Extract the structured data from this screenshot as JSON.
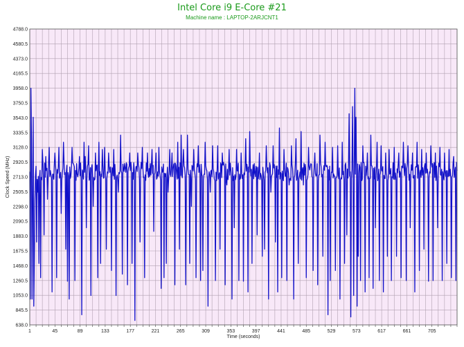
{
  "chart_data": {
    "type": "line",
    "title": "Intel Core i9 E-Core #21",
    "subtitle": "Machine name : LAPTOP-2ARJCNT1",
    "xlabel": "Time (seconds)",
    "ylabel": "Clock Speed (MHz)",
    "x_ticks": [
      "1",
      "45",
      "89",
      "133",
      "177",
      "221",
      "265",
      "309",
      "353",
      "397",
      "441",
      "485",
      "529",
      "573",
      "617",
      "661",
      "705"
    ],
    "y_ticks": [
      "638.0",
      "845.5",
      "1053.0",
      "1260.5",
      "1468.0",
      "1675.5",
      "1883.0",
      "2090.5",
      "2298.0",
      "2505.5",
      "2713.0",
      "2920.5",
      "3128.0",
      "3335.5",
      "3543.0",
      "3750.5",
      "3958.0",
      "4165.5",
      "4373.0",
      "4580.5",
      "4788.0"
    ],
    "xlim": [
      1,
      749
    ],
    "ylim": [
      638.0,
      4788.0
    ],
    "grid": true,
    "colors": {
      "line": "#1010c8",
      "plot_bg": "#f8e8f8",
      "grid": "#b0a0b0",
      "title": "#1a9a1a"
    },
    "baseline": 2790,
    "dips": [
      [
        2,
        1000
      ],
      [
        3,
        3958
      ],
      [
        4,
        3250
      ],
      [
        5,
        1000
      ],
      [
        6,
        2400
      ],
      [
        7,
        3550
      ],
      [
        8,
        900
      ],
      [
        9,
        1600
      ],
      [
        10,
        2400
      ],
      [
        13,
        1800
      ],
      [
        15,
        2500
      ],
      [
        17,
        1500
      ],
      [
        20,
        1300
      ],
      [
        23,
        3100
      ],
      [
        26,
        1900
      ],
      [
        29,
        3000
      ],
      [
        32,
        2400
      ],
      [
        35,
        3128
      ],
      [
        40,
        1100
      ],
      [
        45,
        3050
      ],
      [
        48,
        1300
      ],
      [
        52,
        3128
      ],
      [
        56,
        2200
      ],
      [
        60,
        3200
      ],
      [
        64,
        1700
      ],
      [
        67,
        1250
      ],
      [
        70,
        1000
      ],
      [
        75,
        3128
      ],
      [
        80,
        1260
      ],
      [
        83,
        2900
      ],
      [
        88,
        3000
      ],
      [
        92,
        780
      ],
      [
        96,
        3200
      ],
      [
        98,
        3000
      ],
      [
        100,
        2000
      ],
      [
        104,
        3150
      ],
      [
        108,
        1050
      ],
      [
        112,
        2300
      ],
      [
        116,
        3050
      ],
      [
        120,
        1300
      ],
      [
        122,
        3200
      ],
      [
        125,
        1500
      ],
      [
        128,
        3100
      ],
      [
        132,
        3128
      ],
      [
        135,
        1700
      ],
      [
        139,
        3050
      ],
      [
        144,
        1400
      ],
      [
        148,
        3100
      ],
      [
        152,
        1050
      ],
      [
        156,
        2500
      ],
      [
        160,
        3300
      ],
      [
        163,
        1350
      ],
      [
        167,
        2900
      ],
      [
        172,
        1200
      ],
      [
        176,
        3050
      ],
      [
        180,
        1500
      ],
      [
        185,
        700
      ],
      [
        190,
        3050
      ],
      [
        194,
        1800
      ],
      [
        198,
        3128
      ],
      [
        202,
        1300
      ],
      [
        207,
        3050
      ],
      [
        212,
        2900
      ],
      [
        215,
        3100
      ],
      [
        218,
        1950
      ],
      [
        222,
        3050
      ],
      [
        227,
        3128
      ],
      [
        231,
        1150
      ],
      [
        236,
        1300
      ],
      [
        240,
        1500
      ],
      [
        243,
        2500
      ],
      [
        246,
        3100
      ],
      [
        250,
        3050
      ],
      [
        255,
        1200
      ],
      [
        260,
        3200
      ],
      [
        263,
        1700
      ],
      [
        266,
        3300
      ],
      [
        270,
        3100
      ],
      [
        274,
        1200
      ],
      [
        277,
        3300
      ],
      [
        281,
        1500
      ],
      [
        284,
        2300
      ],
      [
        288,
        3100
      ],
      [
        292,
        1300
      ],
      [
        296,
        3150
      ],
      [
        300,
        1260
      ],
      [
        304,
        1400
      ],
      [
        308,
        3200
      ],
      [
        313,
        900
      ],
      [
        317,
        2500
      ],
      [
        321,
        3150
      ],
      [
        326,
        1260
      ],
      [
        330,
        3150
      ],
      [
        334,
        1700
      ],
      [
        338,
        3050
      ],
      [
        343,
        1200
      ],
      [
        346,
        2600
      ],
      [
        350,
        3100
      ],
      [
        355,
        1000
      ],
      [
        359,
        2000
      ],
      [
        363,
        3100
      ],
      [
        367,
        1260
      ],
      [
        371,
        3050
      ],
      [
        375,
        1250
      ],
      [
        379,
        3250
      ],
      [
        383,
        1100
      ],
      [
        386,
        3350
      ],
      [
        390,
        1500
      ],
      [
        394,
        2900
      ],
      [
        399,
        1900
      ],
      [
        403,
        3050
      ],
      [
        408,
        1600
      ],
      [
        412,
        1700
      ],
      [
        415,
        3150
      ],
      [
        419,
        1000
      ],
      [
        423,
        2500
      ],
      [
        427,
        3150
      ],
      [
        431,
        1800
      ],
      [
        435,
        1100
      ],
      [
        438,
        3400
      ],
      [
        442,
        1300
      ],
      [
        446,
        3100
      ],
      [
        451,
        1260
      ],
      [
        455,
        2600
      ],
      [
        459,
        3150
      ],
      [
        463,
        1000
      ],
      [
        467,
        3250
      ],
      [
        471,
        1500
      ],
      [
        476,
        3350
      ],
      [
        480,
        2600
      ],
      [
        485,
        1300
      ],
      [
        489,
        3128
      ],
      [
        493,
        2900
      ],
      [
        497,
        1400
      ],
      [
        500,
        3050
      ],
      [
        505,
        1200
      ],
      [
        509,
        3300
      ],
      [
        514,
        1600
      ],
      [
        518,
        3200
      ],
      [
        523,
        780
      ],
      [
        527,
        1260
      ],
      [
        531,
        3128
      ],
      [
        536,
        1400
      ],
      [
        540,
        3150
      ],
      [
        544,
        1000
      ],
      [
        548,
        3200
      ],
      [
        552,
        1500
      ],
      [
        556,
        1900
      ],
      [
        560,
        3600
      ],
      [
        563,
        750
      ],
      [
        566,
        3700
      ],
      [
        568,
        1050
      ],
      [
        570,
        3958
      ],
      [
        572,
        3550
      ],
      [
        574,
        900
      ],
      [
        576,
        1600
      ],
      [
        580,
        1260
      ],
      [
        584,
        3150
      ],
      [
        588,
        1100
      ],
      [
        592,
        3050
      ],
      [
        595,
        1300
      ],
      [
        598,
        3300
      ],
      [
        602,
        1150
      ],
      [
        606,
        2000
      ],
      [
        609,
        3200
      ],
      [
        613,
        1260
      ],
      [
        616,
        3150
      ],
      [
        620,
        1100
      ],
      [
        624,
        3050
      ],
      [
        627,
        1600
      ],
      [
        630,
        3100
      ],
      [
        634,
        1260
      ],
      [
        639,
        3128
      ],
      [
        643,
        1600
      ],
      [
        647,
        3050
      ],
      [
        651,
        1300
      ],
      [
        655,
        3200
      ],
      [
        660,
        1260
      ],
      [
        663,
        3150
      ],
      [
        667,
        2000
      ],
      [
        671,
        3050
      ],
      [
        675,
        1100
      ],
      [
        679,
        3200
      ],
      [
        683,
        1400
      ],
      [
        687,
        3100
      ],
      [
        691,
        1700
      ],
      [
        695,
        3050
      ],
      [
        699,
        1250
      ],
      [
        703,
        3150
      ],
      [
        707,
        1260
      ],
      [
        711,
        3050
      ],
      [
        715,
        2000
      ],
      [
        719,
        3128
      ],
      [
        723,
        1260
      ],
      [
        727,
        3050
      ],
      [
        731,
        1500
      ],
      [
        735,
        3100
      ],
      [
        739,
        1300
      ],
      [
        743,
        3000
      ],
      [
        747,
        1260
      ],
      [
        749,
        2800
      ]
    ]
  }
}
